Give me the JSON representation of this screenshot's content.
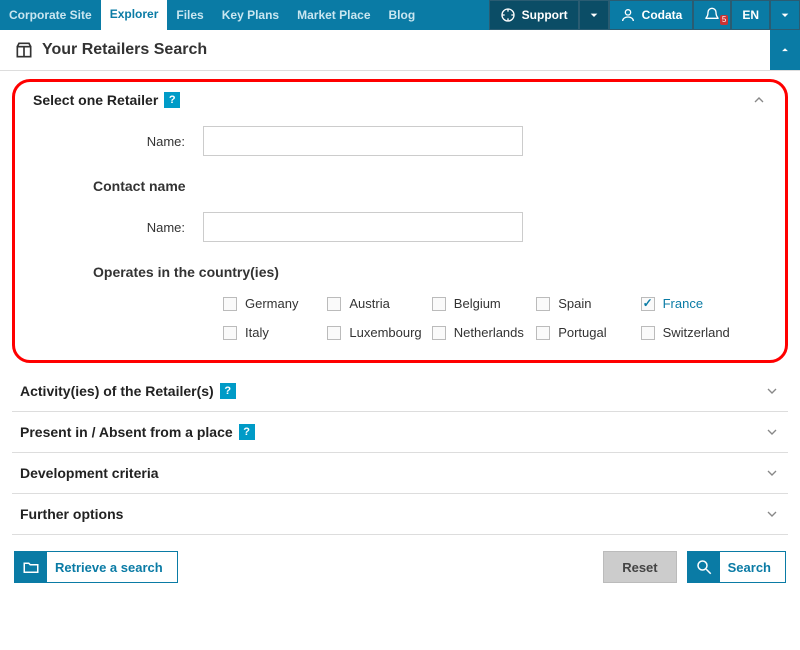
{
  "topnav": {
    "items": [
      {
        "label": "Corporate Site"
      },
      {
        "label": "Explorer",
        "active": true
      },
      {
        "label": "Files"
      },
      {
        "label": "Key Plans"
      },
      {
        "label": "Market Place"
      },
      {
        "label": "Blog"
      }
    ],
    "support": "Support",
    "user": "Codata",
    "notif_count": "5",
    "lang": "EN"
  },
  "header": {
    "title": "Your Retailers Search"
  },
  "panels": {
    "select_retailer": {
      "title": "Select one Retailer",
      "name_label": "Name:",
      "contact_title": "Contact name",
      "contact_name_label": "Name:",
      "operates_title": "Operates in the country(ies)",
      "countries": [
        {
          "label": "Germany",
          "checked": false
        },
        {
          "label": "Austria",
          "checked": false
        },
        {
          "label": "Belgium",
          "checked": false
        },
        {
          "label": "Spain",
          "checked": false
        },
        {
          "label": "France",
          "checked": true
        },
        {
          "label": "Italy",
          "checked": false
        },
        {
          "label": "Luxembourg",
          "checked": false
        },
        {
          "label": "Netherlands",
          "checked": false
        },
        {
          "label": "Portugal",
          "checked": false
        },
        {
          "label": "Switzerland",
          "checked": false
        }
      ]
    },
    "activity": {
      "title": "Activity(ies) of the Retailer(s)"
    },
    "present": {
      "title": "Present in / Absent from a place"
    },
    "development": {
      "title": "Development criteria"
    },
    "further": {
      "title": "Further options"
    }
  },
  "footer": {
    "retrieve": "Retrieve a search",
    "reset": "Reset",
    "search": "Search"
  }
}
